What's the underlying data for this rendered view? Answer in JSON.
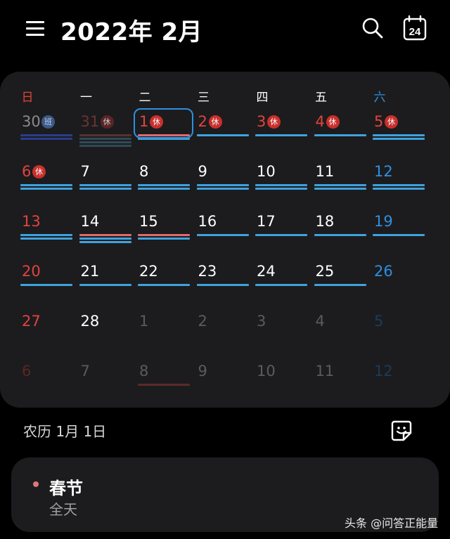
{
  "header": {
    "title": "2022年 2月"
  },
  "calendar": {
    "weekday_labels": [
      "日",
      "一",
      "二",
      "三",
      "四",
      "五",
      "六"
    ],
    "weeks": [
      [
        {
          "day": "30",
          "tag": "班",
          "faded": true
        },
        {
          "day": "31",
          "tag": "休",
          "faded": true
        },
        {
          "day": "1",
          "tag": "休",
          "selected": true
        },
        {
          "day": "2",
          "tag": "休"
        },
        {
          "day": "3",
          "tag": "休"
        },
        {
          "day": "4",
          "tag": "休"
        },
        {
          "day": "5",
          "tag": "休"
        }
      ],
      [
        {
          "day": "6",
          "tag": "休"
        },
        {
          "day": "7"
        },
        {
          "day": "8"
        },
        {
          "day": "9"
        },
        {
          "day": "10"
        },
        {
          "day": "11"
        },
        {
          "day": "12"
        }
      ],
      [
        {
          "day": "13"
        },
        {
          "day": "14"
        },
        {
          "day": "15"
        },
        {
          "day": "16"
        },
        {
          "day": "17"
        },
        {
          "day": "18"
        },
        {
          "day": "19"
        }
      ],
      [
        {
          "day": "20"
        },
        {
          "day": "21"
        },
        {
          "day": "22"
        },
        {
          "day": "23"
        },
        {
          "day": "24"
        },
        {
          "day": "25"
        },
        {
          "day": "26"
        }
      ],
      [
        {
          "day": "27"
        },
        {
          "day": "28"
        },
        {
          "day": "1",
          "faded": true
        },
        {
          "day": "2",
          "faded": true
        },
        {
          "day": "3",
          "faded": true
        },
        {
          "day": "4",
          "faded": true
        },
        {
          "day": "5",
          "faded": true
        }
      ],
      [
        {
          "day": "6",
          "faded": true
        },
        {
          "day": "7",
          "faded": true
        },
        {
          "day": "8",
          "faded": true
        },
        {
          "day": "9",
          "faded": true
        },
        {
          "day": "10",
          "faded": true
        },
        {
          "day": "11",
          "faded": true
        },
        {
          "day": "12",
          "faded": true
        }
      ]
    ]
  },
  "lunar_date": "农历 1月 1日",
  "event": {
    "title": "春节",
    "time": "全天"
  },
  "watermark": "头条 @问答正能量",
  "colors": {
    "background": "#000000",
    "panel": "#1c1c1e",
    "sunday": "#e0443e",
    "saturday": "#2f8fe0",
    "holiday_badge": "#c9302c",
    "workday_badge": "#3a5a8c",
    "event_bar_blue": "#3fa2de",
    "event_bar_red": "#e26a6a",
    "selection": "#2f8fe0"
  }
}
